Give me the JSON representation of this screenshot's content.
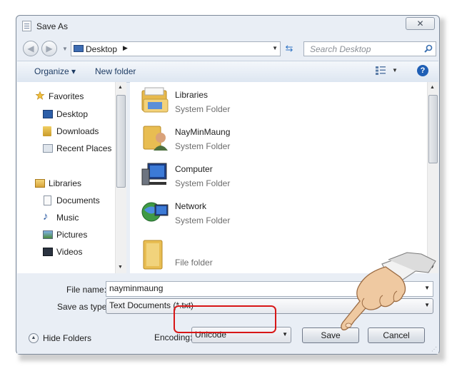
{
  "window": {
    "title": "Save As",
    "close_symbol": "✕"
  },
  "address": {
    "location": "Desktop",
    "search_placeholder": "Search Desktop"
  },
  "toolbar": {
    "organize": "Organize ▾",
    "new_folder": "New folder"
  },
  "nav": {
    "favorites_header": "Favorites",
    "favorites": [
      "Desktop",
      "Downloads",
      "Recent Places"
    ],
    "libraries_header": "Libraries",
    "libraries": [
      "Documents",
      "Music",
      "Pictures",
      "Videos"
    ]
  },
  "files": [
    {
      "name": "Libraries",
      "type": "System Folder"
    },
    {
      "name": "NayMinMaung",
      "type": "System Folder"
    },
    {
      "name": "Computer",
      "type": "System Folder"
    },
    {
      "name": "Network",
      "type": "System Folder"
    },
    {
      "name": "",
      "type": "File folder"
    }
  ],
  "form": {
    "file_name_label": "File name:",
    "file_name_value": "nayminmaung",
    "save_type_label": "Save as type:",
    "save_type_value": "Text Documents (*.txt)",
    "encoding_label": "Encoding:",
    "encoding_value": "Unicode",
    "hide_folders": "Hide Folders",
    "save_button": "Save",
    "cancel_button": "Cancel"
  },
  "colors": {
    "highlight": "#d81616",
    "accent": "#1f5fb5"
  }
}
